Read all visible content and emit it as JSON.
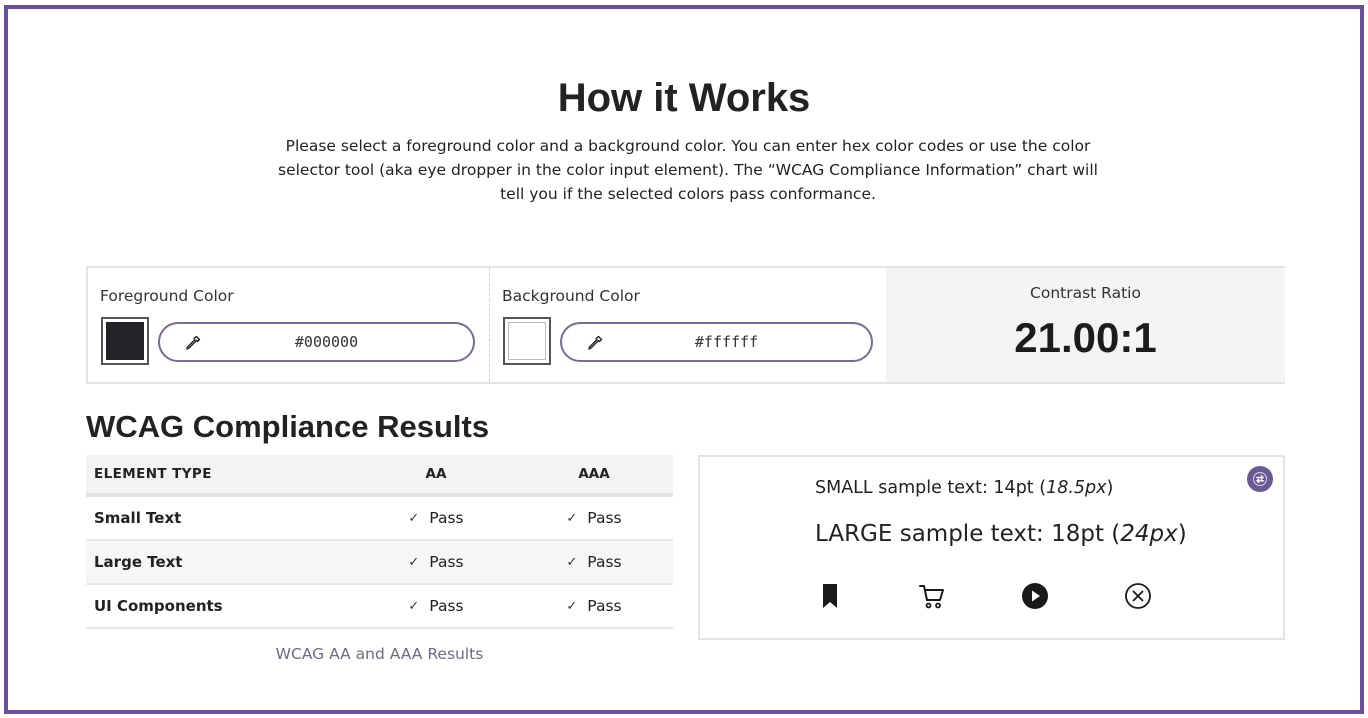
{
  "header": {
    "title": "How it Works",
    "intro": "Please select a foreground color and a background color. You can enter hex color codes or use the color selector tool (aka eye dropper in the color input element). The “WCAG Compliance Information” chart will tell you if the selected colors pass conformance."
  },
  "colors": {
    "accent": "#6b4e9b",
    "foreground": "#000000",
    "background": "#ffffff"
  },
  "picker": {
    "foreground_label": "Foreground Color",
    "foreground_value": "#000000",
    "background_label": "Background Color",
    "background_value": "#ffffff",
    "ratio_label": "Contrast Ratio",
    "ratio_value": "21.00:1",
    "dropper_icon": "eyedropper-icon"
  },
  "results": {
    "heading": "WCAG Compliance Results",
    "columns": [
      "ELEMENT TYPE",
      "AA",
      "AAA"
    ],
    "rows": [
      {
        "type": "Small Text",
        "aa": "Pass",
        "aaa": "Pass"
      },
      {
        "type": "Large Text",
        "aa": "Pass",
        "aaa": "Pass"
      },
      {
        "type": "UI Components",
        "aa": "Pass",
        "aaa": "Pass"
      }
    ],
    "check_icon": "checkmark-icon",
    "caption": "WCAG AA and AAA Results"
  },
  "sample": {
    "small_prefix": "SMALL sample text: 14pt (",
    "small_em": "18.5px",
    "small_suffix": ")",
    "large_prefix": "LARGE sample text: 18pt (",
    "large_em": "24px",
    "large_suffix": ")",
    "swap_icon": "swap-colors-icon",
    "icons": [
      "bookmark-icon",
      "cart-icon",
      "play-icon",
      "close-circle-icon"
    ]
  }
}
